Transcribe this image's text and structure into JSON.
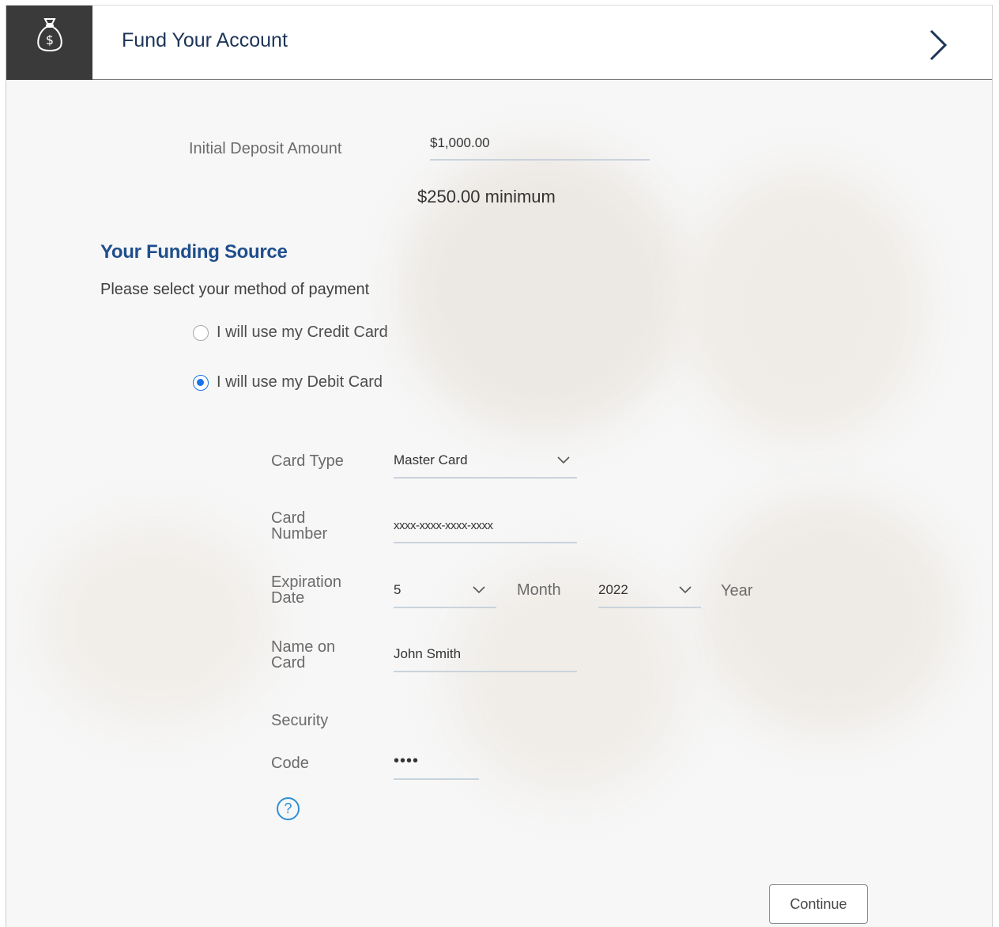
{
  "header": {
    "title": "Fund Your Account",
    "icon": "money-bag-dollar-icon",
    "next_icon": "chevron-right-icon"
  },
  "deposit": {
    "label": "Initial Deposit Amount",
    "value": "$1,000.00",
    "minimum_note": "$250.00 minimum"
  },
  "funding": {
    "title": "Your Funding Source",
    "instruction": "Please select your method of payment",
    "options": [
      {
        "label": "I will use my Credit Card",
        "selected": false
      },
      {
        "label": "I will use my Debit Card",
        "selected": true
      }
    ]
  },
  "card_form": {
    "card_type_label": "Card Type",
    "card_type_value": "Master Card",
    "card_number_label_line1": "Card",
    "card_number_label_line2": "Number",
    "card_number_value": "xxxx-xxxx-xxxx-xxxx",
    "expiration_label_line1": "Expiration",
    "expiration_label_line2": "Date",
    "month_value": "5",
    "month_label": "Month",
    "year_value": "2022",
    "year_label": "Year",
    "name_label_line1": "Name on",
    "name_label_line2": "Card",
    "name_value": "John Smith",
    "security_label_line1": "Security",
    "security_label_line2": "Code",
    "security_value": "••••",
    "help_symbol": "?"
  },
  "actions": {
    "continue_label": "Continue"
  },
  "colors": {
    "title_blue": "#1d3557",
    "section_blue": "#1f4e8c",
    "radio_selected": "#1a73e8",
    "help_blue": "#2e8fd6",
    "header_icon_bg": "#3a3a3a"
  }
}
